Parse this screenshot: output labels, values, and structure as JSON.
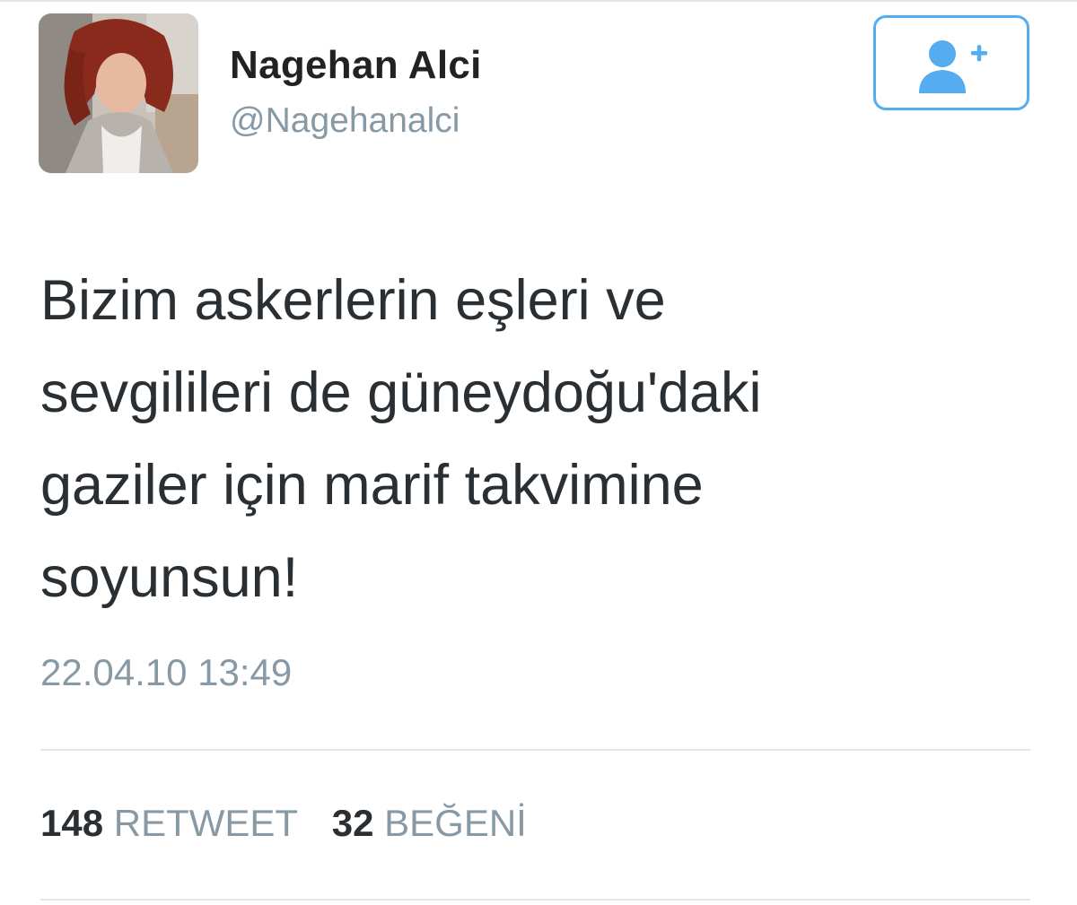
{
  "tweet": {
    "author": {
      "display_name": "Nagehan Alci",
      "handle": "@Nagehanalci"
    },
    "text_lines": [
      "Bizim askerlerin eşleri ve",
      "sevgilileri de güneydoğu'daki",
      "gaziler için marif takvimine",
      "soyunsun!"
    ],
    "timestamp": "22.04.10 13:49",
    "stats": {
      "retweet_count": "148",
      "retweet_label": "RETWEET",
      "like_count": "32",
      "like_label": "BEĞENİ"
    }
  },
  "icons": {
    "follow": "add-user-icon",
    "avatar": "profile-photo"
  },
  "colors": {
    "accent": "#55acee",
    "text": "#292f33",
    "muted": "#8899a6",
    "divider": "#e1e8ed"
  }
}
